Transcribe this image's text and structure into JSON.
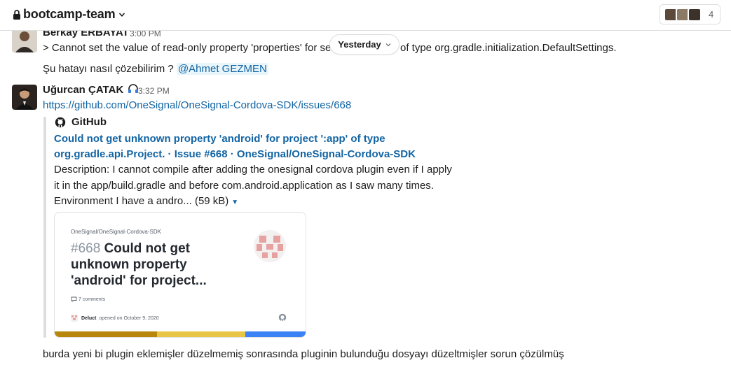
{
  "header": {
    "channel_name": "bootcamp-team",
    "member_count": "4"
  },
  "date_divider": {
    "label": "Yesterday"
  },
  "messages": [
    {
      "sender": "Berkay ERBAYAT",
      "time": "3:00 PM",
      "line1_left": "> Cannot set the value of read-only property 'properties' for se",
      "line1_right": "of type org.gradle.initialization.DefaultSettings.",
      "line2": "Şu hatayı nasıl çözebilirim ?",
      "mention": "@Ahmet GEZMEN"
    },
    {
      "sender": "Uğurcan ÇATAK",
      "status_icon": "headphones-icon",
      "time": "3:32 PM",
      "link": "https://github.com/OneSignal/OneSignal-Cordova-SDK/issues/668",
      "unfurl": {
        "service": "GitHub",
        "title_line1": "Could not get unknown property 'android' for project ':app' of type",
        "title_line2": "org.gradle.api.Project. · Issue #668 · OneSignal/OneSignal-Cordova-SDK",
        "desc_line1": "Description: I cannot compile after adding the onesignal cordova plugin even if I apply",
        "desc_line2": "it in the app/build.gradle and before com.android.application as I saw many times.",
        "desc_line3": "Environment I have a andro... (59 kB)",
        "card": {
          "repo": "OneSignal/OneSignal-Cordova-SDK",
          "issue_number": "#668",
          "issue_title": "Could not get unknown property 'android' for project...",
          "comments": "7 comments",
          "author": "Deluct",
          "opened": "opened on October 9, 2020",
          "stripe_colors": [
            "#b8860b",
            "#e8c547",
            "#3b82f6"
          ]
        }
      }
    },
    {
      "text": "burda yeni bi plugin eklemişler düzelmemiş sonrasında pluginin bulunduğu dosyayı düzeltmişler sorun çözülmüş"
    }
  ],
  "colors": {
    "link": "#1264a3",
    "mention_bg": "#e8f5fa",
    "text": "#1d1c1d",
    "muted": "#616061"
  }
}
